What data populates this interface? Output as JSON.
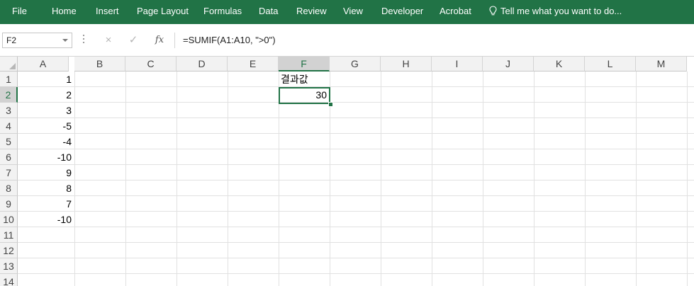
{
  "ribbon": {
    "tabs": [
      "File",
      "Home",
      "Insert",
      "Page Layout",
      "Formulas",
      "Data",
      "Review",
      "View",
      "Developer",
      "Acrobat"
    ],
    "tell_me": "Tell me what you want to do...",
    "color": "#217346"
  },
  "formula_bar": {
    "name_box": "F2",
    "cancel_icon": "×",
    "enter_icon": "✓",
    "fx_label": "fx",
    "formula": "=SUMIF(A1:A10, \">0\")"
  },
  "sheet": {
    "columns": [
      "A",
      "B",
      "C",
      "D",
      "E",
      "F",
      "G",
      "H",
      "I",
      "J",
      "K",
      "L",
      "M"
    ],
    "rows": [
      "1",
      "2",
      "3",
      "4",
      "5",
      "6",
      "7",
      "8",
      "9",
      "10",
      "11",
      "12",
      "13",
      "14"
    ],
    "selected_cell": "F2",
    "column_a_values": [
      "1",
      "2",
      "3",
      "-5",
      "-4",
      "-10",
      "9",
      "8",
      "7",
      "-10"
    ],
    "f1_value": "결과값",
    "f2_value": "30"
  }
}
